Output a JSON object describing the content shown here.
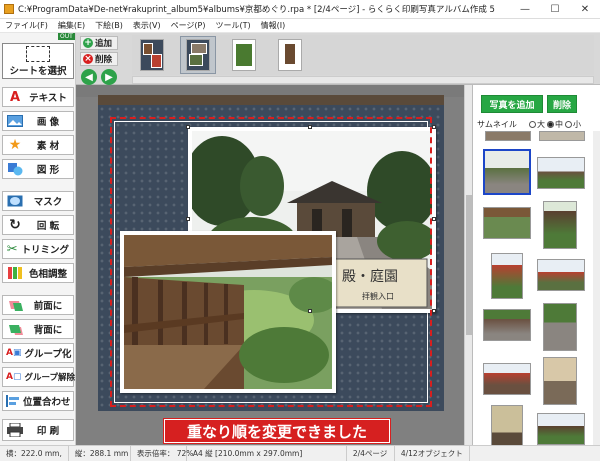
{
  "window": {
    "title": "C:¥ProgramData¥De-net¥rakuprint_album5¥albums¥京都めぐり.rpa * [2/4ページ] - らくらく印刷写真アルバム作成 5",
    "minimize": "—",
    "maximize": "☐",
    "close": "✕"
  },
  "menu": [
    "ファイル(F)",
    "編集(E)",
    "下絵(B)",
    "表示(V)",
    "ページ(P)",
    "ツール(T)",
    "情報(I)"
  ],
  "tools": {
    "out_badge": "OUT",
    "sheet_select": "シートを選択",
    "text": "テキスト",
    "image": "画 像",
    "material": "素 材",
    "shape": "図 形",
    "mask": "マスク",
    "rotate": "回 転",
    "trimming": "トリミング",
    "color_adjust": "色相調整",
    "bring_front": "前面に",
    "send_back": "背面に",
    "group": "グループ化",
    "ungroup": "グループ解除",
    "align": "位置合わせ",
    "print": "印 刷"
  },
  "page_controls": {
    "add": "追加",
    "delete": "削除",
    "prev": "◀",
    "next": "▶"
  },
  "right_panel": {
    "add_photo": "写真を追加",
    "delete": "削除",
    "thumbnail_label": "サムネイル",
    "size_options": [
      "大",
      "中",
      "小"
    ],
    "selected_size": "中"
  },
  "caption": "重なり順を変更できました",
  "status": {
    "width": "横：222.0 mm,",
    "height": "縦：288.1 mm",
    "zoom": "表示倍率： 72%",
    "paper": "A4 縦 [210.0mm x 297.0mm]",
    "page": "2/4ページ",
    "objects": "4/12オブジェクト"
  },
  "colors": {
    "accent_green": "#27a744",
    "caption_red": "#d62020",
    "selection_blue": "#1c46c8",
    "page_background": "#3c4a5c"
  }
}
